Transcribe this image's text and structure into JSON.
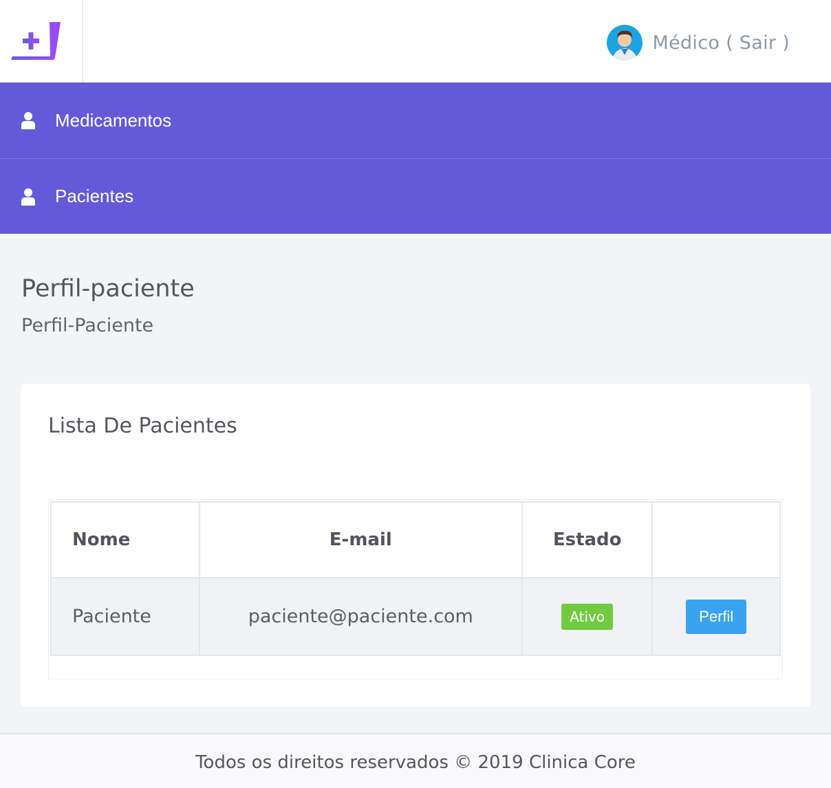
{
  "header": {
    "user_label": "Médico ( Sair )",
    "brand_color": "#645ad9"
  },
  "nav": {
    "items": [
      {
        "label": "Medicamentos",
        "icon": "user-icon"
      },
      {
        "label": "Pacientes",
        "icon": "user-icon"
      }
    ]
  },
  "page": {
    "title": "Perfil-paciente",
    "subtitle": "Perfil-Paciente"
  },
  "card": {
    "title": "Lista De Pacientes",
    "table": {
      "columns": [
        "Nome",
        "E-mail",
        "Estado",
        ""
      ],
      "rows": [
        {
          "nome": "Paciente",
          "email": "paciente@paciente.com",
          "estado": "Ativo",
          "action": "Perfil"
        }
      ]
    }
  },
  "footer": {
    "text": "Todos os direitos reservados © 2019 Clinica Core"
  }
}
